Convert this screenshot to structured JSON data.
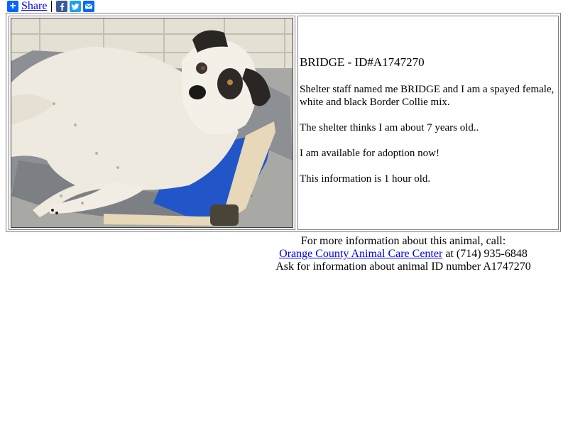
{
  "share": {
    "label": "Share",
    "icons": [
      "plus-icon",
      "facebook-icon",
      "twitter-icon",
      "email-icon"
    ],
    "colors": {
      "plus": "#0166ff",
      "facebook": "#3b5998",
      "twitter": "#1da1f2",
      "email": "#0166ff"
    }
  },
  "animal": {
    "title": "BRIDGE - ID#A1747270",
    "paragraphs": [
      "Shelter staff named me BRIDGE and I am a spayed female, white and black Border Collie mix.",
      "The shelter thinks I am about 7 years old..",
      "I am available for adoption now!",
      "This information is 1 hour old."
    ]
  },
  "contact": {
    "line1": "For more information about this animal, call:",
    "shelter_link": "Orange County Animal Care Center",
    "phone_text": " at (714) 935-6848",
    "line3": "Ask for information about animal ID number A1747270"
  }
}
